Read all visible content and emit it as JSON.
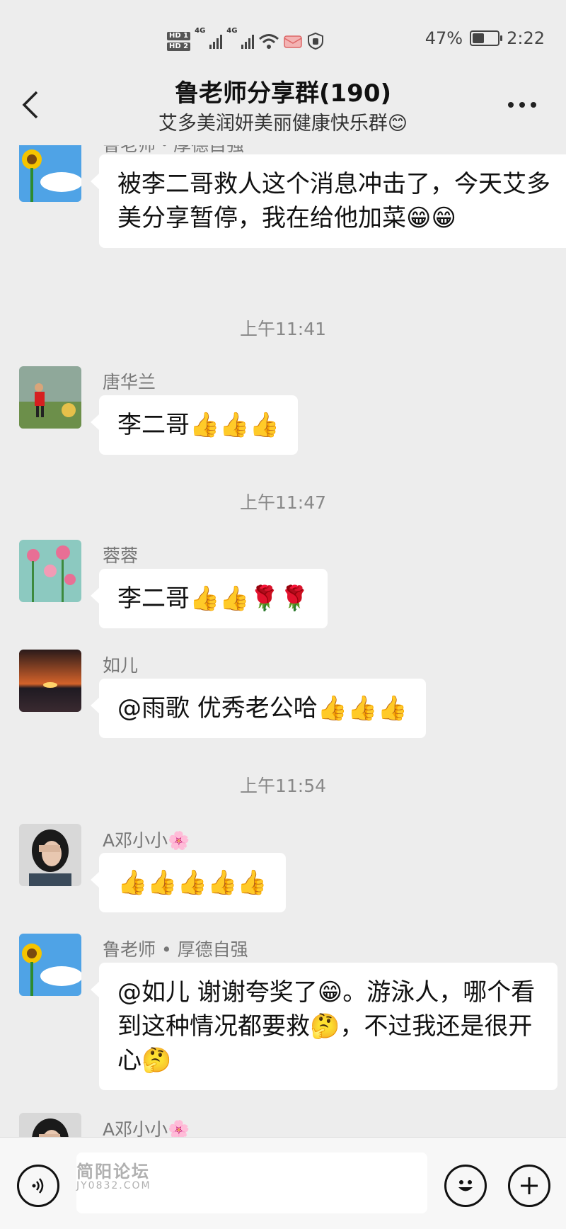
{
  "status_bar": {
    "hd1": "HD 1",
    "hd2": "HD 2",
    "net1": "4G",
    "net2": "4G",
    "battery": "47%",
    "battery_level": 0.47,
    "time": "2:22"
  },
  "header": {
    "title": "鲁老师分享群(190)",
    "subtitle": "艾多美润妍美丽健康快乐群😊",
    "back_icon": "chevron-left",
    "more_icon": "more-dots"
  },
  "messages": [
    {
      "sender": "鲁老师・厚德自强",
      "text": "被李二哥救人这个消息冲击了，今天艾多美分享暂停，我在给他加菜😁😁"
    },
    {
      "time": "上午11:41"
    },
    {
      "sender": "唐华兰",
      "text": "李二哥👍👍👍"
    },
    {
      "time": "上午11:47"
    },
    {
      "sender": "蓉蓉",
      "text": "李二哥👍👍🌹🌹"
    },
    {
      "sender": "如儿",
      "text": "@雨歌  优秀老公哈👍👍👍"
    },
    {
      "time": "上午11:54"
    },
    {
      "sender": "A邓小小🌸",
      "text": "👍👍👍👍👍"
    },
    {
      "sender": "鲁老师 • 厚德自强",
      "text": "@如儿  谢谢夸奖了😁。游泳人，哪个看到这种情况都要救🤔，不过我还是很开心🤔"
    },
    {
      "sender": "A邓小小🌸",
      "text": ""
    }
  ],
  "input_bar": {
    "voice_icon": "voice-icon",
    "emoji_icon": "emoji-icon",
    "plus_icon": "plus-icon",
    "watermark_cn": "简阳论坛",
    "watermark_url": "JY0832.COM"
  }
}
